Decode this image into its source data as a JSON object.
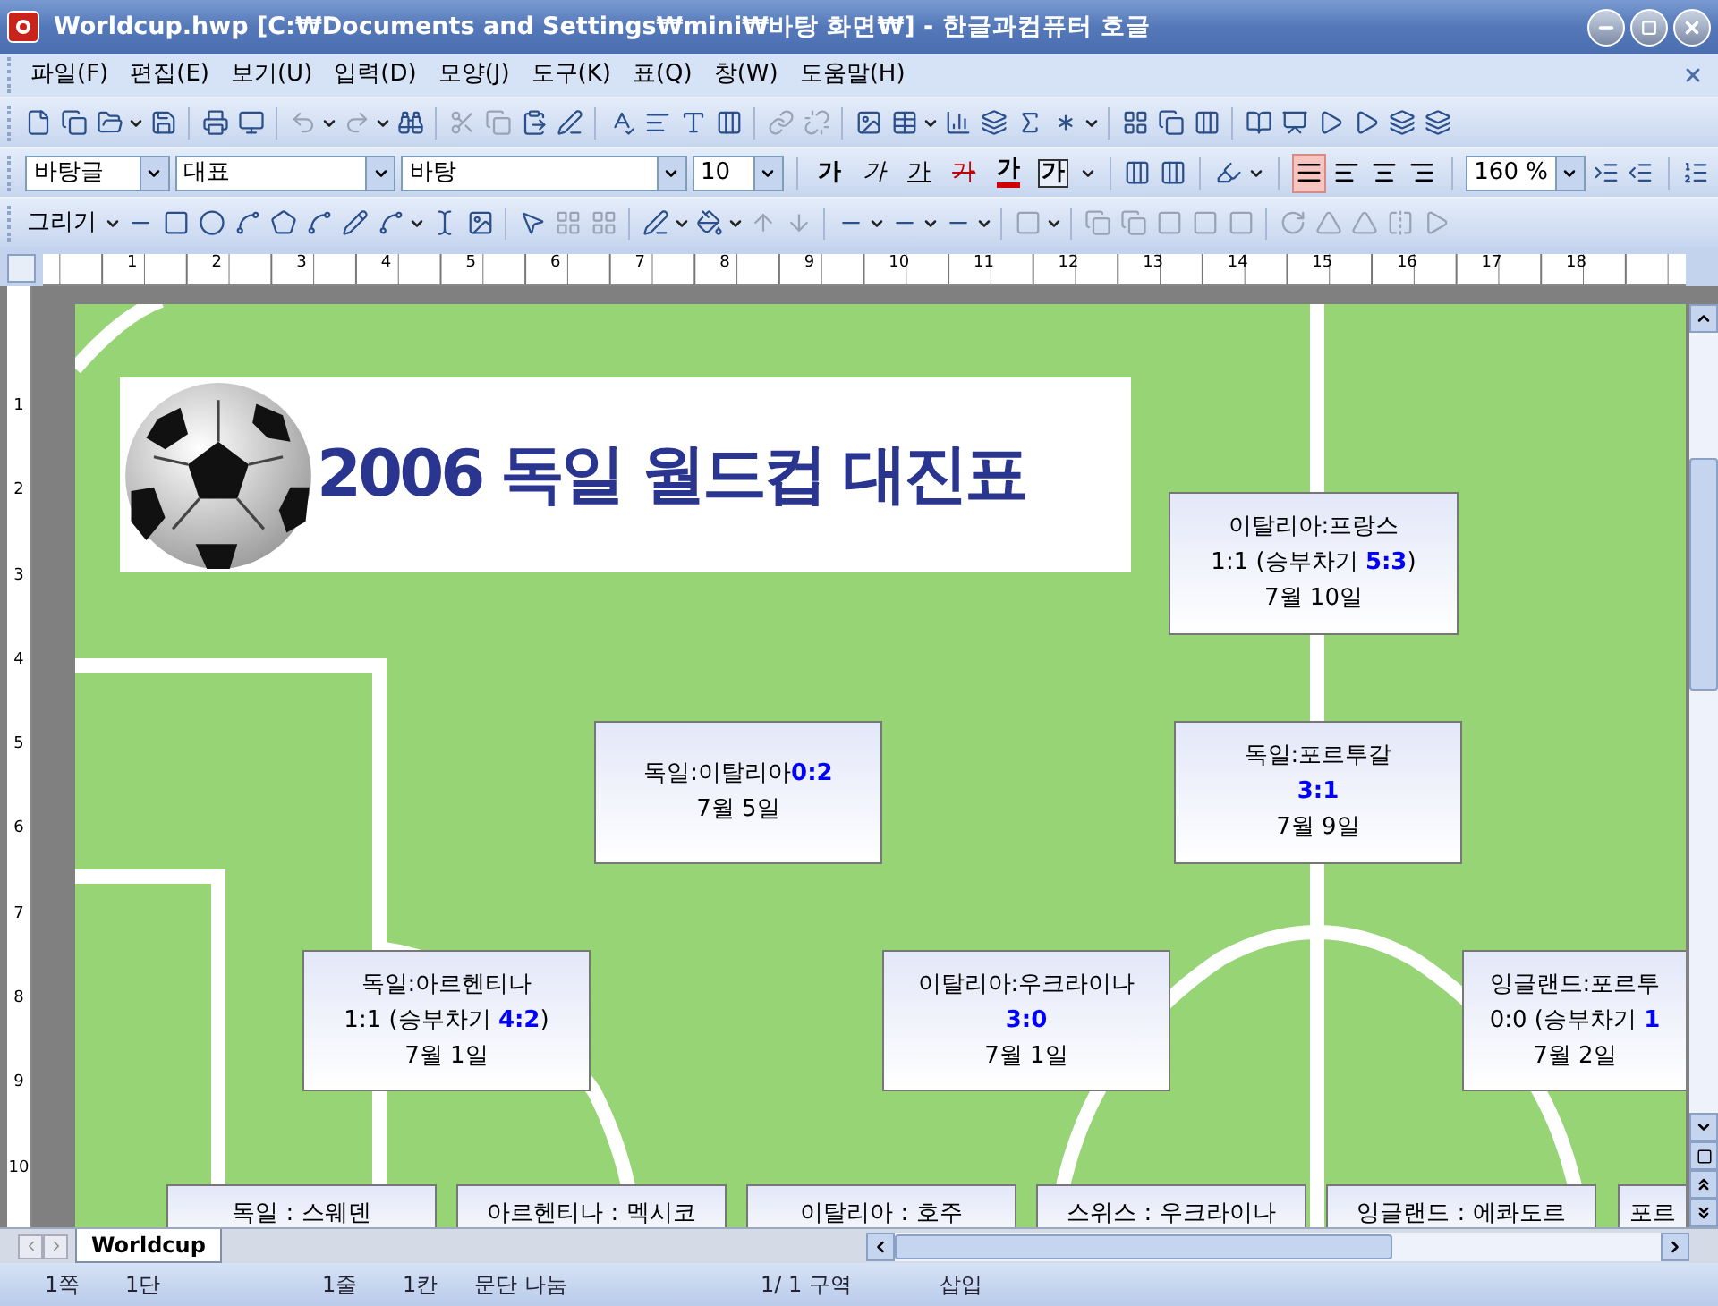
{
  "window": {
    "title": "Worldcup.hwp [C:₩Documents and Settings₩mini₩바탕 화면₩] - 한글과컴퓨터 호글"
  },
  "menu": [
    "파일(F)",
    "편집(E)",
    "보기(U)",
    "입력(D)",
    "모양(J)",
    "도구(K)",
    "표(Q)",
    "창(W)",
    "도움말(H)"
  ],
  "format_bar": {
    "style": "바탕글",
    "font_group": "대표",
    "font": "바탕",
    "size": "10",
    "zoom": "160 %",
    "char_buttons": [
      {
        "kind": "bold",
        "label": "가"
      },
      {
        "kind": "italic",
        "label": "가"
      },
      {
        "kind": "underline",
        "label": "가"
      },
      {
        "kind": "strike",
        "label": "가"
      },
      {
        "kind": "color",
        "label": "가"
      },
      {
        "kind": "boxed",
        "label": "가"
      }
    ],
    "align_buttons": [
      {
        "selected": true
      },
      {
        "selected": false
      },
      {
        "selected": false
      },
      {
        "selected": false
      }
    ]
  },
  "draw_bar": {
    "label": "그리기"
  },
  "ruler": {
    "horizontal": [
      "1",
      "2",
      "3",
      "4",
      "5",
      "6",
      "7",
      "8",
      "9",
      "10",
      "11",
      "12",
      "13",
      "14",
      "15",
      "16",
      "17",
      "18"
    ],
    "vertical": [
      "1",
      "2",
      "3",
      "4",
      "5",
      "6",
      "7",
      "8",
      "9",
      "10"
    ]
  },
  "document": {
    "banner_title": "2006 독일 월드컵 대진표",
    "matches": [
      {
        "lines": [
          "이탈리아:프랑스",
          "1:1 (승부차기 **5:3**)",
          "7월  10일"
        ]
      },
      {
        "lines": [
          "독일:이탈리아**0:2**",
          "7월  5일"
        ]
      },
      {
        "lines": [
          "독일:포르투갈",
          "**3:1**",
          "7월  9일"
        ]
      },
      {
        "lines": [
          "독일:아르헨티나",
          "1:1 (승부차기 **4:2**)",
          "7월  1일"
        ]
      },
      {
        "lines": [
          "이탈리아:우크라이나",
          "**3:0**",
          "7월  1일"
        ]
      },
      {
        "lines": [
          "잉글랜드:포르투",
          "0:0 (승부차기 **1**",
          "7월  2일"
        ]
      },
      {
        "lines": [
          "독일 : 스웨덴"
        ]
      },
      {
        "lines": [
          "아르헨티나 : 멕시코"
        ]
      },
      {
        "lines": [
          "이탈리아 : 호주"
        ]
      },
      {
        "lines": [
          "스위스 : 우크라이나"
        ]
      },
      {
        "lines": [
          "잉글랜드 : 에콰도르"
        ]
      },
      {
        "lines": [
          "포르"
        ]
      }
    ]
  },
  "sheet_tabs": [
    {
      "label": "Worldcup",
      "selected": true
    }
  ],
  "status_bar": [
    "1쪽",
    "1단",
    "1줄",
    "1칸",
    "문단 나눔",
    "1/ 1 구역",
    "삽입"
  ]
}
